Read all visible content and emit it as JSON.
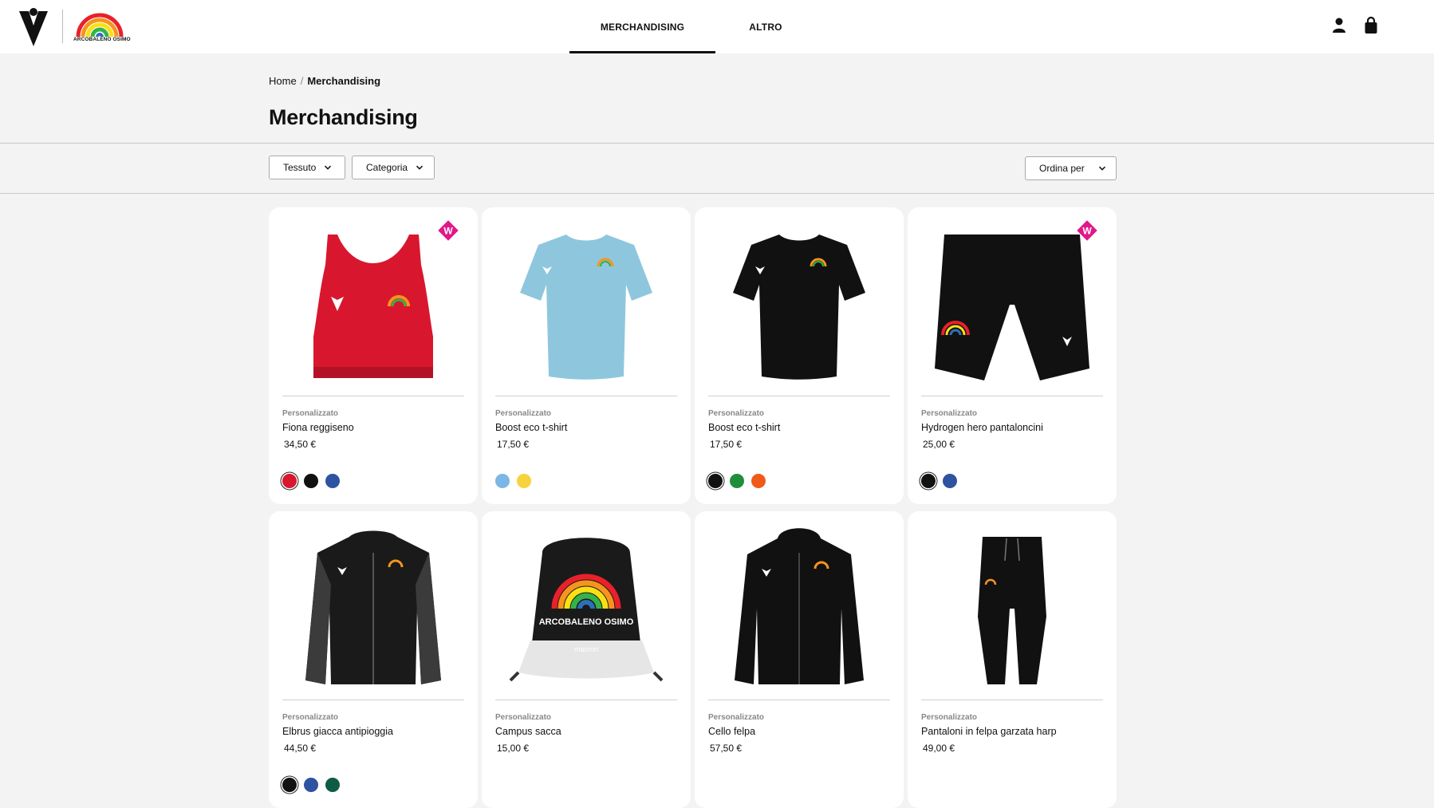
{
  "header": {
    "club_logo_text": "ARCOBALENO OSIMO",
    "nav": [
      {
        "label": "MERCHANDISING",
        "active": true
      },
      {
        "label": "ALTRO",
        "active": false
      }
    ],
    "icons": [
      "user-icon",
      "shopping-bag-icon"
    ]
  },
  "breadcrumb": {
    "home": "Home",
    "separator": "/",
    "current": "Merchandising"
  },
  "page_title": "Merchandising",
  "filters": {
    "fabric": "Tessuto",
    "category": "Categoria",
    "sort": "Ordina per"
  },
  "colors": {
    "red": "#d8172e",
    "black": "#111111",
    "blue": "#2d53a1",
    "light_blue": "#7cb6e4",
    "yellow": "#f6d23c",
    "green": "#1f8e3b",
    "orange": "#f05a19",
    "dark_green": "#0f5b46",
    "badge": "#e0188a"
  },
  "products": [
    {
      "tag": "Personalizzato",
      "name": "Fiona reggiseno",
      "price": "34,50 €",
      "colors": [
        "#d8172e",
        "#111111",
        "#2d53a1"
      ],
      "badge": "W",
      "image": "red-sports-bra"
    },
    {
      "tag": "Personalizzato",
      "name": "Boost eco t-shirt",
      "price": "17,50 €",
      "colors": [
        "#7cb6e4",
        "#f6d23c"
      ],
      "badge": "",
      "image": "light-blue-tshirt"
    },
    {
      "tag": "Personalizzato",
      "name": "Boost eco t-shirt",
      "price": "17,50 €",
      "colors": [
        "#111111",
        "#1f8e3b",
        "#f05a19"
      ],
      "badge": "",
      "image": "black-tshirt"
    },
    {
      "tag": "Personalizzato",
      "name": "Hydrogen hero pantaloncini",
      "price": "25,00 €",
      "colors": [
        "#111111",
        "#2d53a1"
      ],
      "badge": "W",
      "image": "black-shorts"
    },
    {
      "tag": "Personalizzato",
      "name": "Elbrus giacca antipioggia",
      "price": "44,50 €",
      "colors": [
        "#111111",
        "#2d53a1",
        "#0f5b46"
      ],
      "badge": "",
      "image": "black-rain-jacket"
    },
    {
      "tag": "Personalizzato",
      "name": "Campus sacca",
      "price": "15,00 €",
      "colors": [],
      "badge": "",
      "image": "gym-sack",
      "image_text": [
        "ARCOBALENO OSIMO",
        "macron"
      ]
    },
    {
      "tag": "Personalizzato",
      "name": "Cello felpa",
      "price": "57,50 €",
      "colors": [],
      "badge": "",
      "image": "black-hoodie"
    },
    {
      "tag": "Personalizzato",
      "name": "Pantaloni in felpa garzata harp",
      "price": "49,00 €",
      "colors": [],
      "badge": "",
      "image": "black-sweatpants"
    }
  ]
}
